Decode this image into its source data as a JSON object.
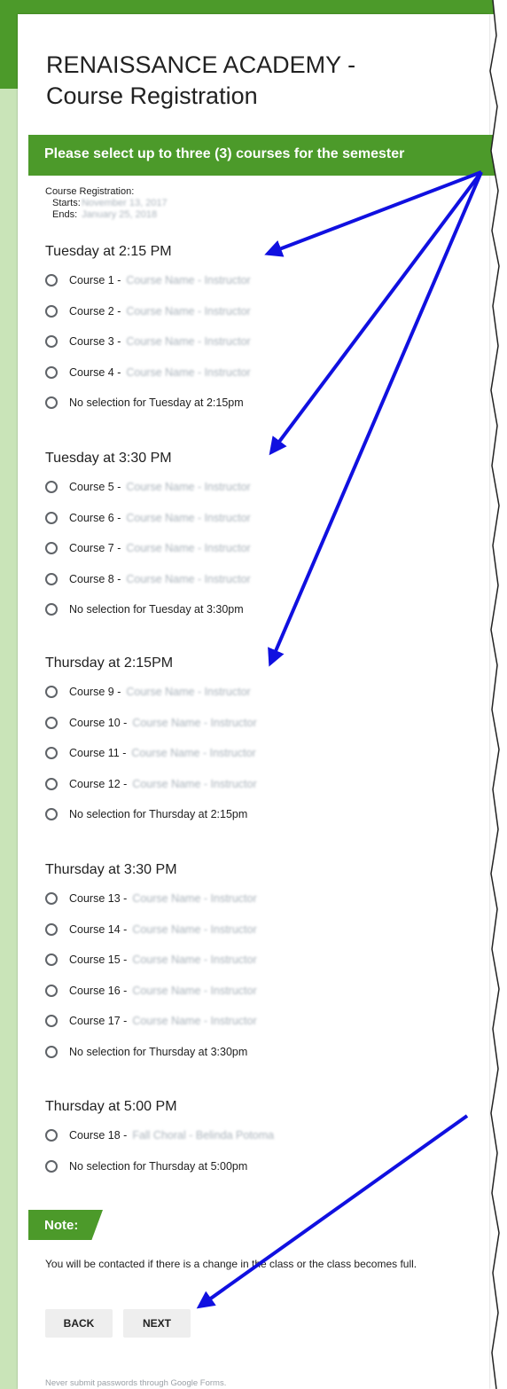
{
  "form": {
    "title_line1": "RENAISSANCE ACADEMY -",
    "title_line2": "Course Registration",
    "header": "Please select up to three (3) courses for the semester",
    "meta": {
      "heading": "Course Registration:",
      "starts_label": "Starts:",
      "starts_value": "November 13, 2017",
      "ends_label": "Ends:",
      "ends_value": "January 25, 2018"
    }
  },
  "sections": [
    {
      "title": "Tuesday at 2:15 PM",
      "options": [
        {
          "prefix": "Course 1 -",
          "detail": "Course Name - Instructor"
        },
        {
          "prefix": "Course 2 -",
          "detail": "Course Name - Instructor"
        },
        {
          "prefix": "Course 3 -",
          "detail": "Course Name - Instructor"
        },
        {
          "prefix": "Course 4 -",
          "detail": "Course Name - Instructor"
        },
        {
          "prefix": "No selection for Tuesday at 2:15pm",
          "detail": ""
        }
      ]
    },
    {
      "title": "Tuesday at 3:30 PM",
      "options": [
        {
          "prefix": "Course 5 -",
          "detail": "Course Name - Instructor"
        },
        {
          "prefix": "Course 6 -",
          "detail": "Course Name - Instructor"
        },
        {
          "prefix": "Course 7 -",
          "detail": "Course Name - Instructor"
        },
        {
          "prefix": "Course 8 -",
          "detail": "Course Name - Instructor"
        },
        {
          "prefix": "No selection for Tuesday at 3:30pm",
          "detail": ""
        }
      ]
    },
    {
      "title": "Thursday at 2:15PM",
      "options": [
        {
          "prefix": "Course 9 -",
          "detail": "Course Name - Instructor"
        },
        {
          "prefix": "Course 10 -",
          "detail": "Course Name - Instructor"
        },
        {
          "prefix": "Course 11 -",
          "detail": "Course Name - Instructor"
        },
        {
          "prefix": "Course 12 -",
          "detail": "Course Name - Instructor"
        },
        {
          "prefix": "No selection for Thursday at 2:15pm",
          "detail": ""
        }
      ]
    },
    {
      "title": "Thursday at 3:30 PM",
      "options": [
        {
          "prefix": "Course 13 -",
          "detail": "Course Name - Instructor"
        },
        {
          "prefix": "Course 14 -",
          "detail": "Course Name - Instructor"
        },
        {
          "prefix": "Course 15 -",
          "detail": "Course Name - Instructor"
        },
        {
          "prefix": "Course 16 -",
          "detail": "Course Name - Instructor"
        },
        {
          "prefix": "Course 17 -",
          "detail": "Course Name - Instructor"
        },
        {
          "prefix": "No selection for Thursday at 3:30pm",
          "detail": ""
        }
      ]
    },
    {
      "title": "Thursday at 5:00 PM",
      "options": [
        {
          "prefix": "Course 18 -",
          "detail": "Fall Choral - Belinda Potoma"
        },
        {
          "prefix": "No selection for Thursday at 5:00pm",
          "detail": ""
        }
      ]
    }
  ],
  "note": {
    "label": "Note:",
    "text": "You will be contacted if there is a change in the class or the class becomes full."
  },
  "buttons": {
    "back": "BACK",
    "next": "NEXT"
  },
  "footer": "Never submit passwords through Google Forms.",
  "colors": {
    "accent": "#4c9a2a",
    "arrow": "#1010e0"
  }
}
